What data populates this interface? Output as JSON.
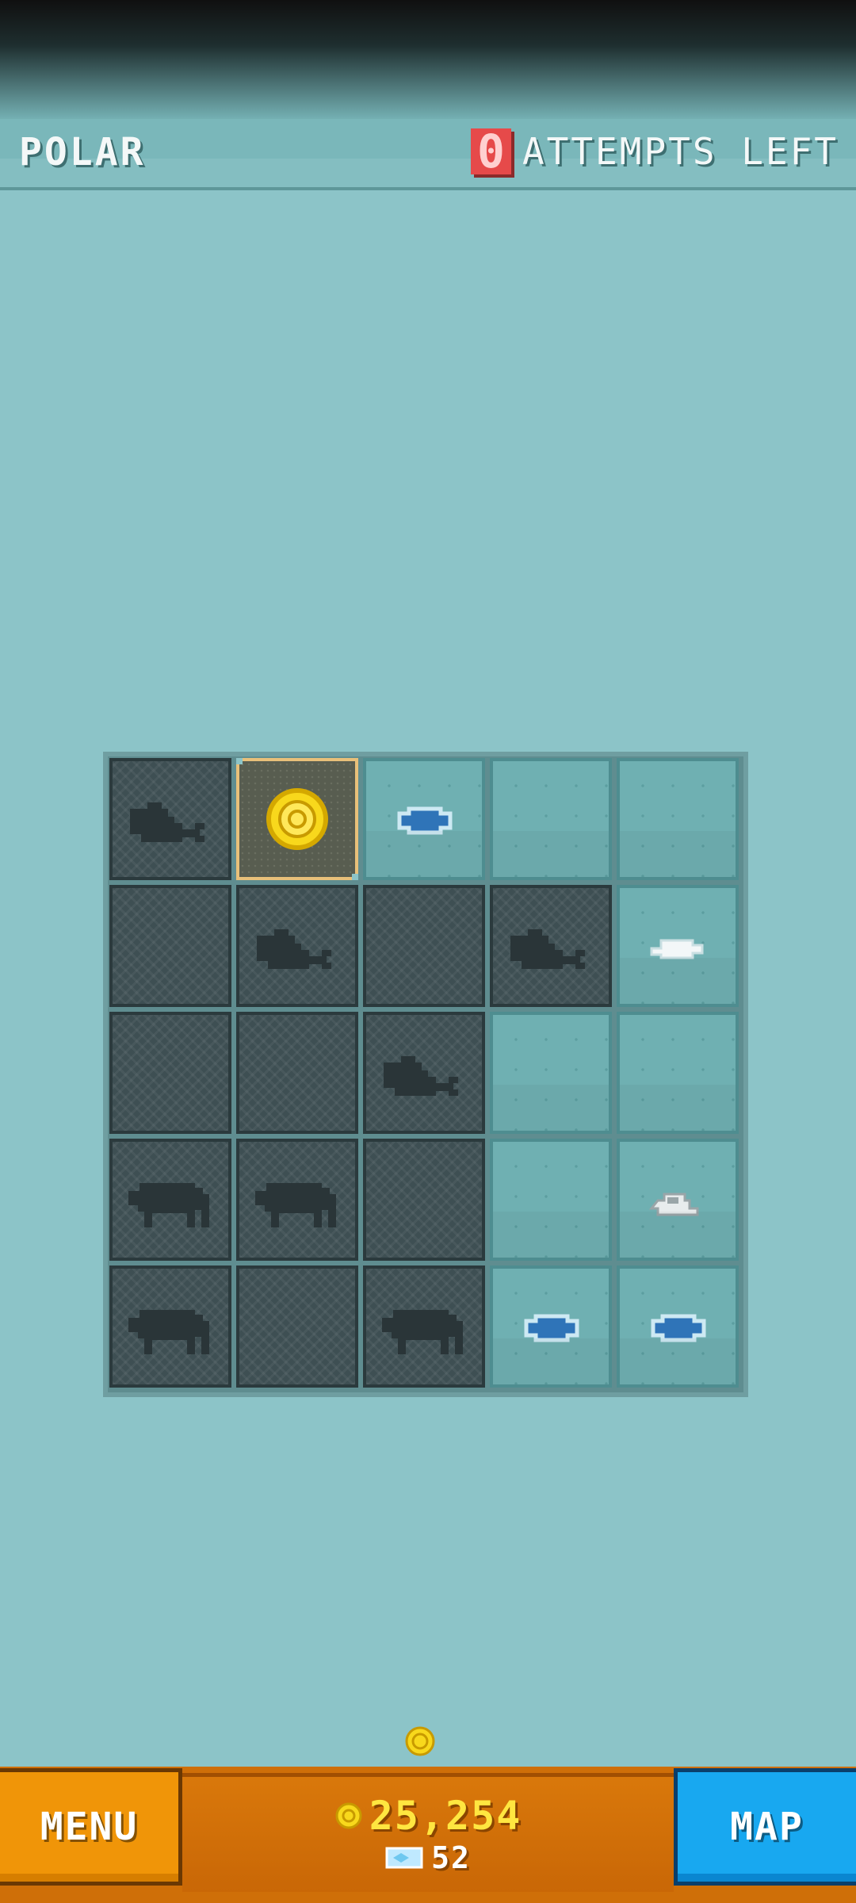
{
  "header": {
    "level_name": "POLAR",
    "attempts_count": "0",
    "attempts_label": "ATTEMPTS LEFT"
  },
  "board": {
    "rows": [
      [
        "seal-silhouette",
        "coin",
        "water-hole",
        "ice",
        "ice"
      ],
      [
        "dark",
        "seal-silhouette",
        "dark",
        "seal-silhouette",
        "fish"
      ],
      [
        "dark",
        "dark",
        "seal-silhouette",
        "ice",
        "ice"
      ],
      [
        "muskox-silhouette",
        "muskox-silhouette",
        "dark",
        "ice",
        "rock"
      ],
      [
        "muskox-silhouette",
        "dark",
        "muskox-silhouette",
        "water-hole",
        "water-hole"
      ]
    ]
  },
  "bottom_bar": {
    "menu_label": "MENU",
    "map_label": "MAP",
    "coins": "25,254",
    "gems": "52"
  },
  "colors": {
    "background": "#8cc4c8",
    "menu_button": "#f09508",
    "map_button": "#18a8f0",
    "currency_bar": "#cf6f08",
    "coin": "#ffe640",
    "attempts": "#e64a4a"
  }
}
